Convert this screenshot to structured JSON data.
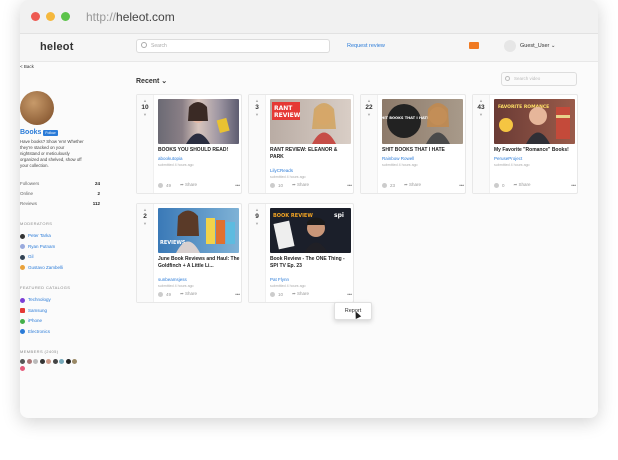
{
  "browser": {
    "url_scheme": "http://",
    "url_host": "heleot.com"
  },
  "nav": {
    "logo": "heleot",
    "search_placeholder": "Search",
    "request_review": "Request review",
    "user": "Guest_User"
  },
  "sidebar": {
    "back": "< Back",
    "name": "Books",
    "follow": "Follow",
    "description": "Have books? Show 'em! Whether they're stacked on your nightstand or meticulously organized and shelved, show off your collection.",
    "stats": [
      {
        "label": "Followers",
        "value": "24"
      },
      {
        "label": "Online",
        "value": "2"
      },
      {
        "label": "Reviews",
        "value": "112"
      }
    ],
    "moderators_heading": "MODERATORS",
    "moderators": [
      "Peter Tarka",
      "Ryan Putnam",
      "Gil",
      "Gustavo Zambelli"
    ],
    "catalogs_heading": "FEATURED CATALOGS",
    "catalogs": [
      "Technology",
      "Samsung",
      "iPhone",
      "Electronics"
    ],
    "members_heading": "MEMBERS (2405)"
  },
  "feed": {
    "sort": "Recent",
    "side_search_placeholder": "Search video",
    "submitted": "submitted 4 hours ago",
    "share": "Share",
    "more": "•••",
    "cards": [
      {
        "votes": "10",
        "title": "BOOKS YOU SHOULD READ!",
        "author": "abookutopia",
        "comments": "49"
      },
      {
        "votes": "3",
        "title": "RANT REVIEW: ELEANOR & PARK",
        "author": "LilyCReads",
        "comments": "10"
      },
      {
        "votes": "22",
        "title": "SHIT BOOKS THAT I HATE",
        "author": "Rainbow Rowell",
        "comments": "23"
      },
      {
        "votes": "43",
        "title": "My Favorite \"Romance\" Books!",
        "author": "PeruseProject",
        "comments": "0"
      },
      {
        "votes": "2",
        "title": "June Book Reviews and Haul: The Goldfinch + A Little Li...",
        "author": "sunbeamsjess",
        "comments": "49"
      },
      {
        "votes": "9",
        "title": "Book Review - The ONE Thing - SPI TV Ep. 23",
        "author": "Pat Flynn",
        "comments": "10"
      }
    ],
    "thumb_texts": {
      "rant": "RANT REVIEW",
      "shit": "SHIT BOOKS THAT I HATE",
      "fav": "FAVORITE ROMANCE",
      "reviews": "REVIEWS",
      "bookreview": "BOOK REVIEW",
      "spi": "spi"
    }
  },
  "menu": {
    "report": "Report"
  },
  "colors": {
    "accent": "#2a7bd8",
    "notify": "#f07a22"
  }
}
